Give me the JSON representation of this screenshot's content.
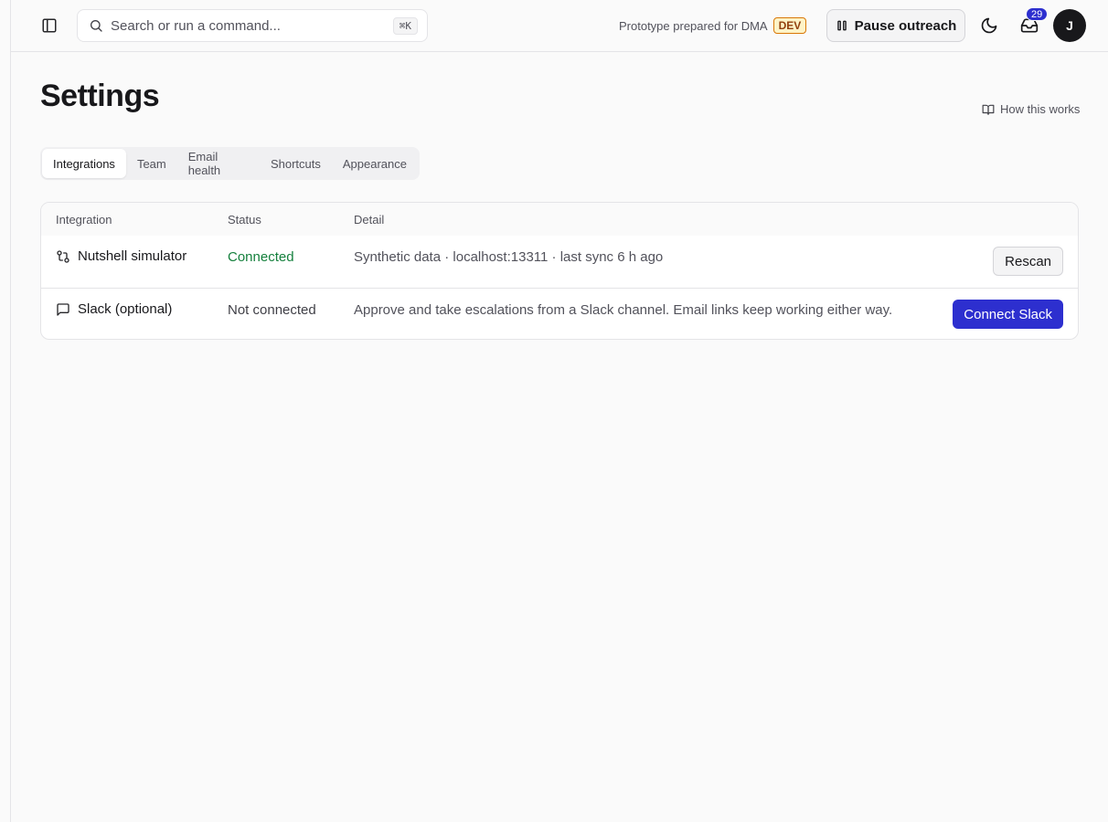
{
  "topbar": {
    "search": {
      "placeholder": "Search or run a command...",
      "shortcut": "⌘K"
    },
    "prototype_label": "Prototype prepared for DMA",
    "env_badge": "DEV",
    "pause_button": "Pause outreach",
    "notification_count": "29",
    "avatar_initial": "J",
    "accent_color": "#2d2fcf"
  },
  "page": {
    "title": "Settings",
    "help_link": "How this works"
  },
  "tabs": [
    {
      "label": "Integrations",
      "active": true
    },
    {
      "label": "Team"
    },
    {
      "label": "Email health"
    },
    {
      "label": "Shortcuts"
    },
    {
      "label": "Appearance"
    }
  ],
  "table": {
    "headers": {
      "integration": "Integration",
      "status": "Status",
      "detail": "Detail"
    },
    "rows": [
      {
        "icon": "git-compare-icon",
        "name": "Nutshell simulator",
        "status": "Connected",
        "status_color": "#15803d",
        "detail": "Synthetic data · localhost:13311 · last sync 6 h ago",
        "action": "Rescan"
      },
      {
        "icon": "message-square-icon",
        "name": "Slack (optional)",
        "status": "Not connected",
        "detail": "Approve and take escalations from a Slack channel. Email links keep working either way.",
        "action": "Connect Slack"
      }
    ]
  }
}
